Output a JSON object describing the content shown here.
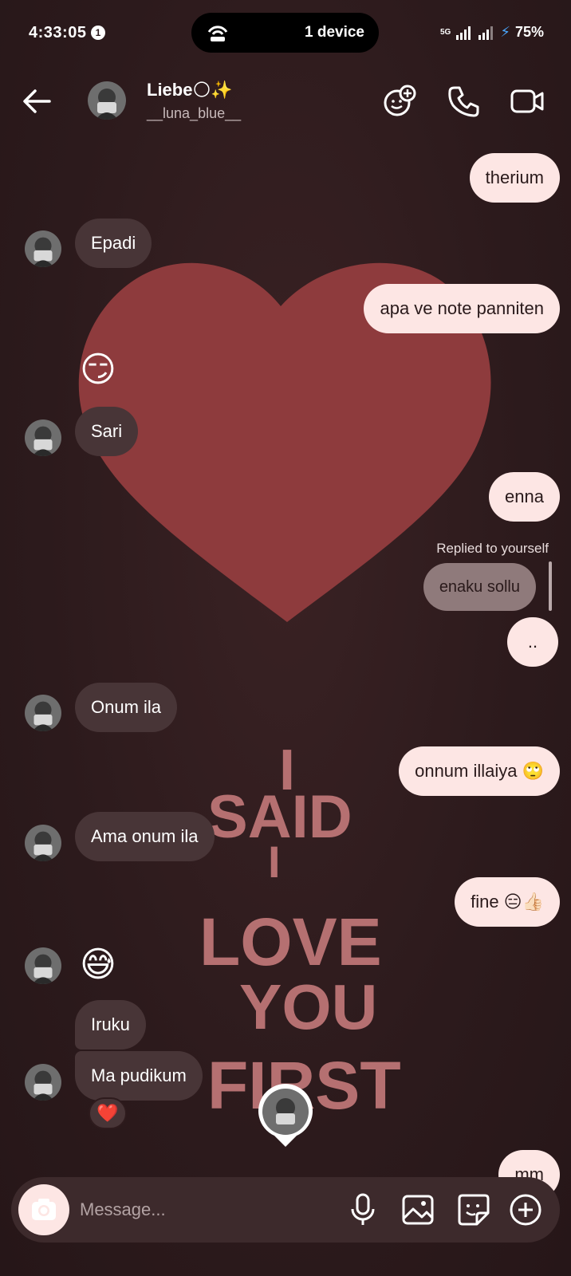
{
  "status_bar": {
    "time": "4:33:05",
    "notification_count": "1",
    "island_text": "1 device",
    "network": "5G",
    "battery": "75%"
  },
  "header": {
    "name": "Liebe🌕✨",
    "username": "__luna_blue__"
  },
  "messages": {
    "m1": "therium",
    "m2": "Epadi",
    "m3": "apa ve note panniten",
    "m4": "😏",
    "m5": "Sari",
    "m6": "enna",
    "reply_label": "Replied to yourself",
    "reply_quote": "enaku sollu",
    "m7": "..",
    "m8": "Onum ila",
    "m9": "onnum illaiya 🙄",
    "m10": "Ama onum ila",
    "m11": "fine 😑👍🏻",
    "m12": "😅",
    "m13": "Iruku",
    "m14": "Ma pudikum",
    "reaction": "❤️",
    "m15": "mm"
  },
  "background_art": {
    "lines": [
      "I",
      "SAID",
      "I",
      "LOVE",
      "YOU",
      "FIRST"
    ]
  },
  "composer": {
    "placeholder": "Message..."
  }
}
